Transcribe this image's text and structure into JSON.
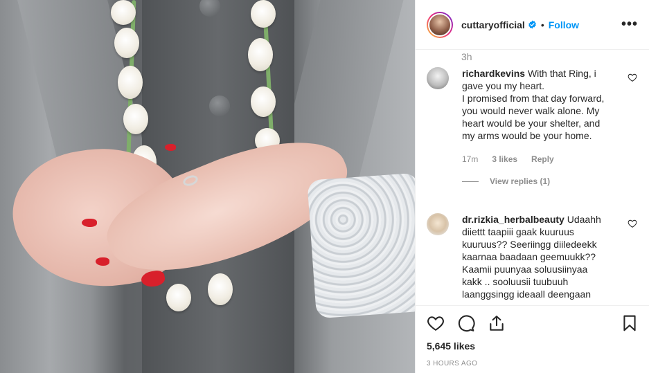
{
  "post": {
    "author": "cuttaryofficial",
    "follow_label": "Follow",
    "separator": "•",
    "more_label": "•••",
    "posted_ago": "3h",
    "likes": "5,645 likes",
    "timestamp": "3 HOURS AGO"
  },
  "comments": [
    {
      "user": "richardkevins",
      "text": "With that Ring, i gave you my heart.",
      "text2": "I promised from that day forward, you would never walk alone. My heart would be your shelter, and my arms would be your home.",
      "age": "17m",
      "likes": "3 likes",
      "reply_label": "Reply",
      "view_replies": "View replies (1)"
    },
    {
      "user": "dr.rizkia_herbalbeauty",
      "text": "Udaahh diiettt taapiii gaak kuuruus kuuruus?? Seeriingg diiledeekk kaarnaa baadaan geemuukk?? Kaamii puunyaa soluusiinyaa kakk .. sooluusii tuubuuh laanggsingg ideaall deengaan"
    }
  ],
  "colors": {
    "accent": "#0095f6",
    "muted": "#8e8e8e",
    "text": "#262626",
    "nail": "#d8202b"
  },
  "icons": [
    "verified-badge-icon",
    "more-options-icon",
    "heart-icon",
    "comment-icon",
    "share-icon",
    "bookmark-icon"
  ]
}
